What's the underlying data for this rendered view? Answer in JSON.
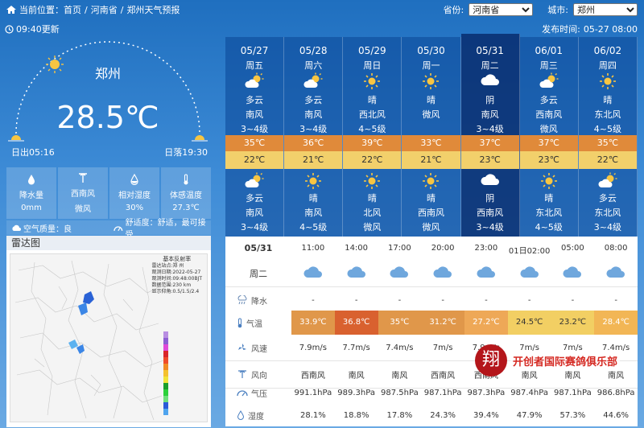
{
  "breadcrumb": {
    "prefix": "当前位置：",
    "items": [
      "首页",
      "河南省",
      "郑州天气预报"
    ],
    "separator": "/"
  },
  "selectors": {
    "province_label": "省份:",
    "province_value": "河南省",
    "city_label": "城市:",
    "city_value": "郑州"
  },
  "update_time": "09:40更新",
  "publish": {
    "label": "发布时间:",
    "value": "05-27 08:00"
  },
  "current": {
    "city": "郑州",
    "temperature": "28.5℃",
    "sunrise": "日出05:16",
    "sunset": "日落19:30"
  },
  "stats": [
    {
      "label": "降水量",
      "value": "0mm",
      "icon": "raindrop-icon"
    },
    {
      "label": "西南风",
      "value": "微风",
      "icon": "wind-icon"
    },
    {
      "label": "相对湿度",
      "value": "30%",
      "icon": "humidity-icon"
    },
    {
      "label": "体感温度",
      "value": "27.3℃",
      "icon": "thermometer-icon"
    }
  ],
  "air": {
    "quality": "空气质量：良",
    "comfort": "舒适度：舒适，最可接受"
  },
  "radar": {
    "title": "雷达图",
    "info_title": "基本反射率",
    "info_lines": [
      "雷达站点:郑 州",
      "观测日期:2022-05-27",
      "观测时间:09:48:00BJT",
      "数据范围:230 km",
      "显示仰角:0.5/1.5/2.4"
    ]
  },
  "days": [
    {
      "date": "05/27",
      "week": "周五",
      "day_weather": "多云",
      "day_wind": "南风",
      "day_level": "3~4级",
      "high": "35℃",
      "low": "22℃",
      "night_weather": "多云",
      "night_wind": "南风",
      "night_level": "3~4级",
      "day_icon": "partly-cloudy-icon",
      "night_icon": "partly-cloudy-icon"
    },
    {
      "date": "05/28",
      "week": "周六",
      "day_weather": "多云",
      "day_wind": "南风",
      "day_level": "3~4级",
      "high": "36℃",
      "low": "21℃",
      "night_weather": "晴",
      "night_wind": "南风",
      "night_level": "4~5级",
      "day_icon": "partly-cloudy-icon",
      "night_icon": "sun-icon"
    },
    {
      "date": "05/29",
      "week": "周日",
      "day_weather": "晴",
      "day_wind": "西北风",
      "day_level": "4~5级",
      "high": "39℃",
      "low": "22℃",
      "night_weather": "晴",
      "night_wind": "北风",
      "night_level": "微风",
      "day_icon": "sun-icon",
      "night_icon": "sun-icon"
    },
    {
      "date": "05/30",
      "week": "周一",
      "day_weather": "晴",
      "day_wind": "微风",
      "day_level": "",
      "high": "33℃",
      "low": "21℃",
      "night_weather": "晴",
      "night_wind": "西南风",
      "night_level": "微风",
      "day_icon": "sun-icon",
      "night_icon": "sun-icon"
    },
    {
      "date": "05/31",
      "week": "周二",
      "day_weather": "阴",
      "day_wind": "南风",
      "day_level": "3~4级",
      "high": "37℃",
      "low": "23℃",
      "night_weather": "阴",
      "night_wind": "西南风",
      "night_level": "3~4级",
      "day_icon": "cloud-icon",
      "night_icon": "cloud-icon"
    },
    {
      "date": "06/01",
      "week": "周三",
      "day_weather": "多云",
      "day_wind": "西南风",
      "day_level": "微风",
      "high": "37℃",
      "low": "23℃",
      "night_weather": "晴",
      "night_wind": "东北风",
      "night_level": "4~5级",
      "day_icon": "partly-cloudy-icon",
      "night_icon": "sun-icon"
    },
    {
      "date": "06/02",
      "week": "周四",
      "day_weather": "晴",
      "day_wind": "东北风",
      "day_level": "4~5级",
      "high": "35℃",
      "low": "22℃",
      "night_weather": "多云",
      "night_wind": "东北风",
      "night_level": "3~4级",
      "day_icon": "sun-icon",
      "night_icon": "partly-cloudy-icon"
    }
  ],
  "hourly": {
    "date": "05/31",
    "week": "周二",
    "times": [
      "11:00",
      "14:00",
      "17:00",
      "20:00",
      "23:00",
      "01日02:00",
      "05:00",
      "08:00"
    ],
    "rows": {
      "rain": {
        "label": "降水",
        "values": [
          "-",
          "-",
          "-",
          "-",
          "-",
          "-",
          "-",
          "-"
        ]
      },
      "temp": {
        "label": "气温",
        "values": [
          "33.9℃",
          "36.8℃",
          "35℃",
          "31.2℃",
          "27.2℃",
          "24.5℃",
          "23.2℃",
          "28.4℃"
        ]
      },
      "speed": {
        "label": "风速",
        "values": [
          "7.9m/s",
          "7.7m/s",
          "7.4m/s",
          "7m/s",
          "7.9m/s",
          "7m/s",
          "7m/s",
          "7.4m/s"
        ]
      },
      "dir": {
        "label": "风向",
        "values": [
          "西南风",
          "南风",
          "南风",
          "西南风",
          "西南风",
          "南风",
          "南风",
          "南风"
        ]
      },
      "pressure": {
        "label": "气压",
        "values": [
          "991.1hPa",
          "989.3hPa",
          "987.5hPa",
          "987.1hPa",
          "987.3hPa",
          "987.4hPa",
          "987.1hPa",
          "986.8hPa"
        ]
      },
      "humidity": {
        "label": "湿度",
        "values": [
          "28.1%",
          "18.8%",
          "17.8%",
          "24.3%",
          "39.4%",
          "47.9%",
          "57.3%",
          "44.6%"
        ]
      }
    },
    "temp_colors": [
      "#e0974a",
      "#d9612f",
      "#e0974a",
      "#e0974a",
      "#eea857",
      "#f2cf63",
      "#f2cf63",
      "#f2b655"
    ]
  },
  "watermark": {
    "logo": "翔",
    "text": "开创者国际赛鸽俱乐部"
  }
}
